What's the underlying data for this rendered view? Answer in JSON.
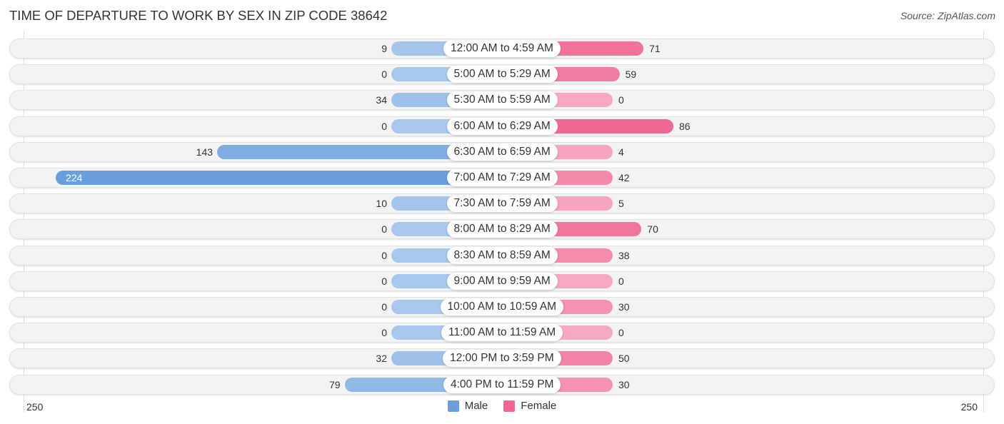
{
  "header": {
    "title": "TIME OF DEPARTURE TO WORK BY SEX IN ZIP CODE 38642",
    "source": "Source: ZipAtlas.com"
  },
  "colors": {
    "male_strong": "#6a9fdc",
    "male_light": "#a7c7ec",
    "female_strong": "#f06892",
    "female_light": "#f7a8c1"
  },
  "legend": {
    "male_label": "Male",
    "female_label": "Female"
  },
  "axis": {
    "left_label": "250",
    "right_label": "250"
  },
  "chart_data": {
    "type": "bar",
    "orientation": "horizontal-diverging",
    "title": "TIME OF DEPARTURE TO WORK BY SEX IN ZIP CODE 38642",
    "source": "Source: ZipAtlas.com",
    "xlim": [
      -250,
      250
    ],
    "x_tick_labels": [
      "250",
      "250"
    ],
    "legend": [
      "Male",
      "Female"
    ],
    "legend_position": "bottom-center",
    "categories": [
      "12:00 AM to 4:59 AM",
      "5:00 AM to 5:29 AM",
      "5:30 AM to 5:59 AM",
      "6:00 AM to 6:29 AM",
      "6:30 AM to 6:59 AM",
      "7:00 AM to 7:29 AM",
      "7:30 AM to 7:59 AM",
      "8:00 AM to 8:29 AM",
      "8:30 AM to 8:59 AM",
      "9:00 AM to 9:59 AM",
      "10:00 AM to 10:59 AM",
      "11:00 AM to 11:59 AM",
      "12:00 PM to 3:59 PM",
      "4:00 PM to 11:59 PM"
    ],
    "series": [
      {
        "name": "Male",
        "values": [
          9,
          0,
          34,
          0,
          143,
          224,
          10,
          0,
          0,
          0,
          0,
          0,
          32,
          79
        ]
      },
      {
        "name": "Female",
        "values": [
          71,
          59,
          0,
          86,
          4,
          42,
          5,
          70,
          38,
          0,
          30,
          0,
          50,
          30
        ]
      }
    ]
  }
}
